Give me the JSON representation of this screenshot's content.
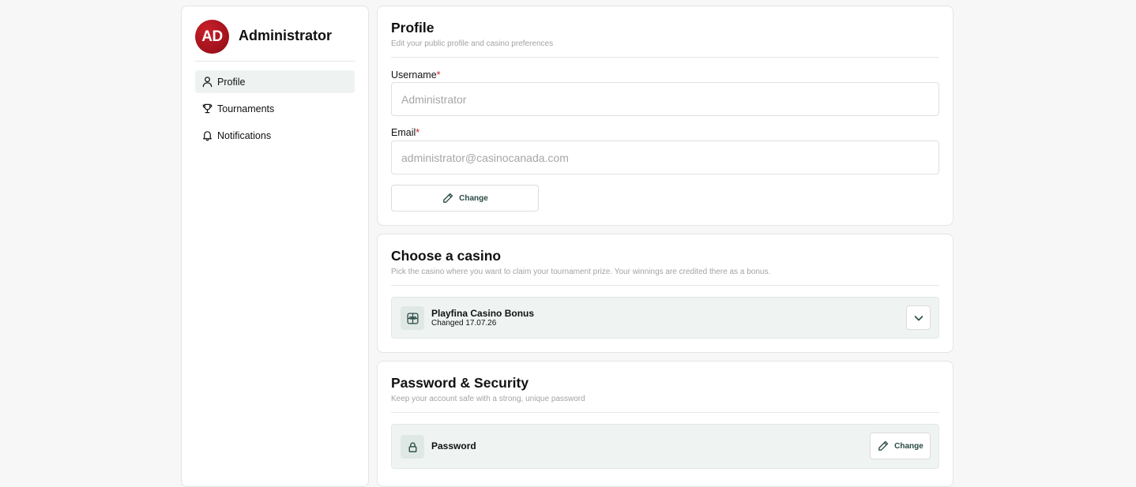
{
  "user": {
    "initials": "AD",
    "name": "Administrator"
  },
  "nav": {
    "items": [
      {
        "label": "Profile",
        "icon": "user-icon",
        "active": true
      },
      {
        "label": "Tournaments",
        "icon": "trophy-icon",
        "active": false
      },
      {
        "label": "Notifications",
        "icon": "bell-icon",
        "active": false
      }
    ]
  },
  "profile": {
    "title": "Profile",
    "subtitle": "Edit your public profile and casino preferences",
    "username_label": "Username",
    "username_placeholder": "Administrator",
    "email_label": "Email",
    "email_placeholder": "administrator@casinocanada.com",
    "required_marker": "*",
    "change_label": "Change"
  },
  "casino": {
    "title": "Choose a casino",
    "subtitle": "Pick the casino where you want to claim your tournament prize. Your winnings are credited there as a bonus.",
    "selected_name": "Playfina Casino Bonus",
    "selected_meta": "Changed 17.07.26"
  },
  "security": {
    "title": "Password & Security",
    "subtitle": "Keep your account safe with a strong, unique password",
    "password_label": "Password",
    "change_label": "Change"
  },
  "colors": {
    "accent": "#c8202a",
    "row_bg": "#eff4f2",
    "button_text": "#2a4a44"
  }
}
